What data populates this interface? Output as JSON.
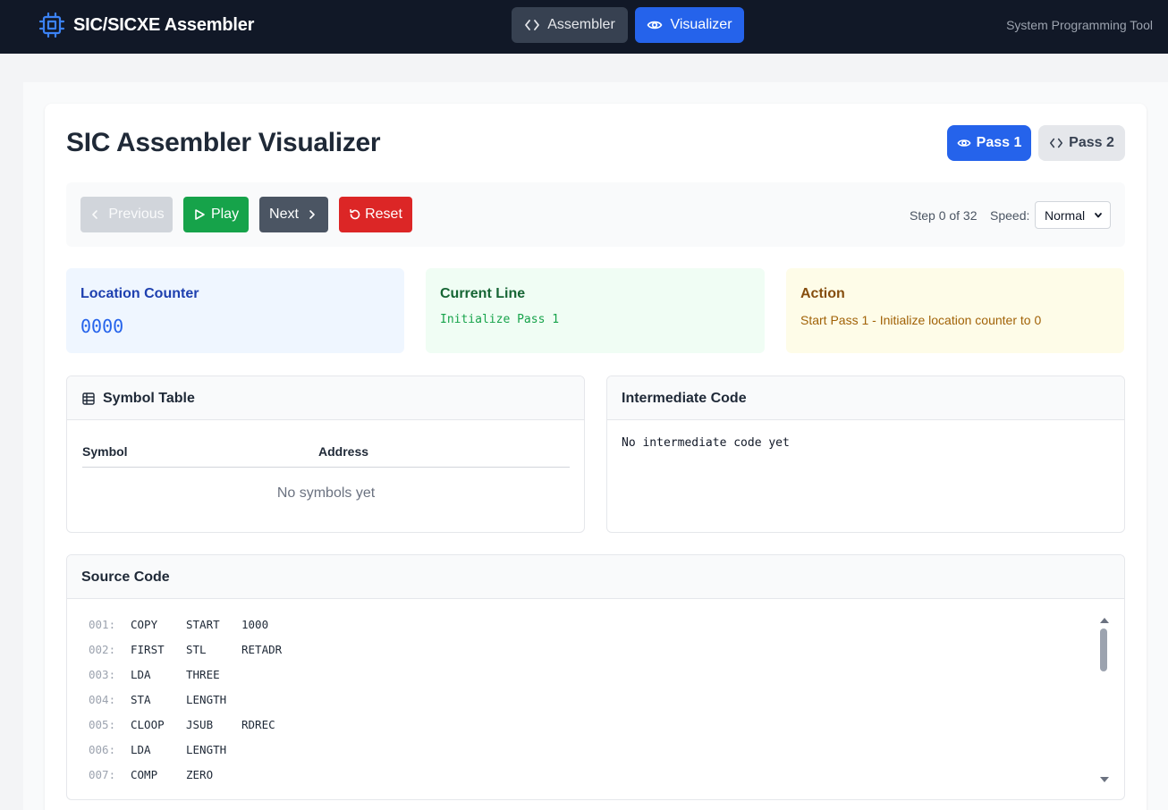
{
  "app": {
    "title": "SIC/SICXE Assembler",
    "tagline": "System Programming Tool",
    "nav": {
      "assembler_label": "Assembler",
      "visualizer_label": "Visualizer"
    }
  },
  "visualizer": {
    "title": "SIC Assembler Visualizer",
    "pass1_label": "Pass 1",
    "pass2_label": "Pass 2"
  },
  "controls": {
    "previous_label": "Previous",
    "play_label": "Play",
    "next_label": "Next",
    "reset_label": "Reset",
    "step_text": "Step 0 of 32",
    "speed_label": "Speed:",
    "speed_value": "Normal"
  },
  "status": {
    "location_counter": {
      "heading": "Location Counter",
      "value": "0000"
    },
    "current_line": {
      "heading": "Current Line",
      "value": "Initialize Pass 1"
    },
    "action": {
      "heading": "Action",
      "value": "Start Pass 1 - Initialize location counter to 0"
    }
  },
  "symbol_table": {
    "title": "Symbol Table",
    "col_symbol": "Symbol",
    "col_address": "Address",
    "empty": "No symbols yet"
  },
  "intermediate": {
    "title": "Intermediate Code",
    "empty": "No intermediate code yet"
  },
  "source": {
    "title": "Source Code",
    "lines": [
      {
        "no": "001:",
        "label": "COPY",
        "op": "START",
        "arg": "1000"
      },
      {
        "no": "002:",
        "label": "FIRST",
        "op": "STL",
        "arg": "RETADR"
      },
      {
        "no": "003:",
        "label": "LDA",
        "op": "THREE",
        "arg": ""
      },
      {
        "no": "004:",
        "label": "STA",
        "op": "LENGTH",
        "arg": ""
      },
      {
        "no": "005:",
        "label": "CLOOP",
        "op": "JSUB",
        "arg": "RDREC"
      },
      {
        "no": "006:",
        "label": "LDA",
        "op": "LENGTH",
        "arg": ""
      },
      {
        "no": "007:",
        "label": "COMP",
        "op": "ZERO",
        "arg": ""
      }
    ]
  },
  "colors": {
    "nav_bg": "#111827",
    "primary": "#2563eb",
    "play": "#16a34a",
    "reset": "#dc2626",
    "next": "#4b5563"
  }
}
